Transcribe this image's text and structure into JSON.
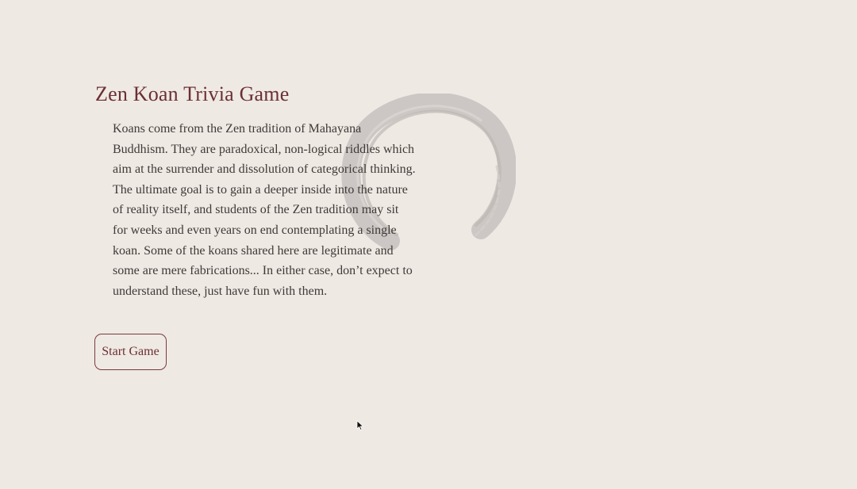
{
  "game": {
    "title": "Zen Koan Trivia Game",
    "description": "Koans come from the Zen tradition of Mahayana Buddhism. They are paradoxical, non-logical riddles which aim at the surrender and dissolution of categorical thinking. The ultimate goal is to gain a deeper inside into the nature of reality itself, and students of the Zen tradition may sit for weeks and even years on end contemplating a single koan. Some of the koans shared here are legitimate and some are mere fabrications... In either case, don’t expect to understand these, just have fun with them.",
    "start_button_label": "Start Game"
  },
  "colors": {
    "background": "#efe9e3",
    "accent": "#6b2f35",
    "body_text": "#3e3a38",
    "enso": "#c9c5c2"
  },
  "icons": {
    "decoration": "enso-circle-icon",
    "pointer": "mouse-cursor-icon"
  }
}
